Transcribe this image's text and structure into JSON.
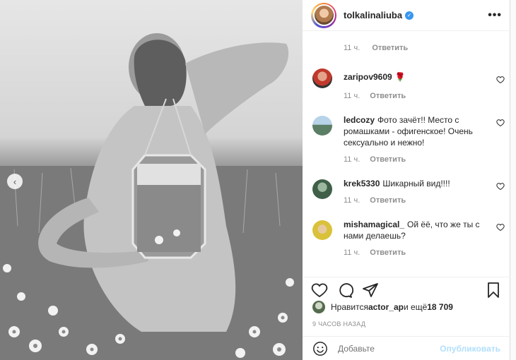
{
  "post": {
    "author": {
      "username": "tolkalinaliuba",
      "verified_icon": "verified-badge-icon"
    },
    "more_label": "•••",
    "caption_meta": {
      "time": "11 ч.",
      "reply": "Ответить"
    },
    "comments": [
      {
        "username": "zaripov9609",
        "text": "🌹",
        "time": "11 ч.",
        "reply": "Ответить",
        "avatar_color": "#c0392b"
      },
      {
        "username": "ledcozy",
        "text": "Фото зачёт!! Место с ромашками - офигенское! Очень сексуально и нежно!",
        "time": "11 ч.",
        "reply": "Ответить",
        "avatar_color": "#6f8fa8"
      },
      {
        "username": "krek5330",
        "text": "Шикарный вид!!!!",
        "time": "11 ч.",
        "reply": "Ответить",
        "avatar_color": "#3f5f48"
      },
      {
        "username": "mishamagical_",
        "text": "Ой ёё, что же ты с нами делаешь?",
        "time": "11 ч.",
        "reply": "Ответить",
        "avatar_color": "#d9c23a"
      }
    ],
    "likes": {
      "prefix": "Нравится ",
      "user": "actor_ap",
      "suffix": " и ещё ",
      "count": "18 709"
    },
    "timestamp": "9 ЧАСОВ НАЗАД",
    "add_comment": {
      "placeholder": "Добавьте",
      "publish": "Опубликовать"
    },
    "carousel_prev": "‹",
    "colors": {
      "accent": "#3897f0",
      "publish_disabled": "#b2dffc",
      "muted": "#8e8e8e"
    }
  }
}
